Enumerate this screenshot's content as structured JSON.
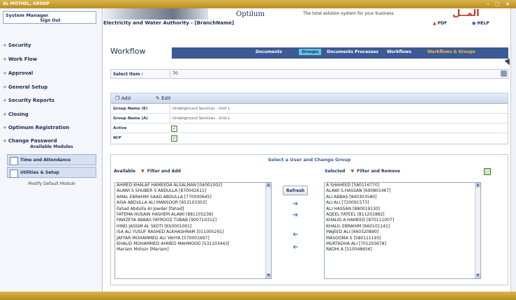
{
  "titlebar": {
    "text": "AL MOTHEL, GROUP",
    "buttons": "– □ ×"
  },
  "sidebar": {
    "user_name": "System Manager",
    "sign_out": "Sign Out",
    "items": [
      {
        "label": "Security"
      },
      {
        "label": "Work Flow"
      },
      {
        "label": "Approval"
      },
      {
        "label": "General Setup"
      },
      {
        "label": "Security Reports"
      },
      {
        "label": "Closing"
      },
      {
        "label": "Optimum Registration"
      },
      {
        "label": "Change Password"
      }
    ],
    "modules_title": "Available Modules",
    "modules": [
      {
        "label": "Time and Attendance"
      },
      {
        "label": "Utilities & Setup"
      }
    ],
    "modify_default": "Modify Default Module"
  },
  "header": {
    "product": "Optilum",
    "tagline": "The total solution system for your business",
    "arabic_logo": "المــل",
    "authority": "Electricity and Water Authority - [BranchName]",
    "pdf_label": "PDF",
    "help_label": "HELP"
  },
  "workflow": {
    "title": "Workflow",
    "tabs": [
      {
        "label": "Documents"
      },
      {
        "label": "Groups"
      },
      {
        "label": "Documents Processes"
      },
      {
        "label": "Workflows"
      },
      {
        "label": "Workflows & Groups"
      }
    ]
  },
  "select_row": {
    "label": "Select Item :",
    "value": "70"
  },
  "group": {
    "toolbar": {
      "add": "Add",
      "edit": "Edit"
    },
    "rows": [
      {
        "label": "Group Name (E)",
        "value": "Underground Services - Unit L"
      },
      {
        "label": "Group Name (A)",
        "value": "Underground Services - Unit L"
      },
      {
        "label": "Active",
        "value": "✓"
      },
      {
        "label": "W/F",
        "value": "✓"
      }
    ]
  },
  "members": {
    "title": "Select a User and Change Group",
    "available_label": "Available",
    "available_filter": "Filter and Add",
    "selected_label": "Selected",
    "selected_filter": "Filter and Remove",
    "refresh": "Refresh",
    "available": [
      "AHMED KHALAF HAMEEDA ALSALMAN [04001002]",
      "ALAWI S SHUBER S ABDULLA [870042611]",
      "AMAL EBRAHIM SAAD ABDULLA [770000645]",
      "ASIA ABDULLA ALI MANSOOR [653103303]",
      "Fahad Abdulla Al-Jowder [fahad]",
      "FATEMA HUSAIN HASHEM ALAWI [881105238]",
      "FAWZEYA ABBAS FAYROOZ TUBAB [900710312]",
      "HIND JASSIM AL SKOTI [650001091]",
      "ISA ALI YUSUF RASHED ALKHASHRAM [011005291]",
      "JAFFAR MOHAMMED ALI YAHYA [570001697]",
      "KHALID MOHAMMED AHMED MAHMOOD [531103443]",
      "Mariam Mohsin [Mariam]"
    ],
    "selected": [
      "A SHAHEED [580116770]",
      "ALAWI S.HASSAN [690801467]",
      "ALI ABBAS [840303580]",
      "ALI ALI [720091573]",
      "ALI HASSAN [880019130]",
      "AQEEL FATEEL [811201882]",
      "KHALID A.HAMEED [870111007]",
      "KHALIL EBRAHIM [660101141]",
      "MAJEED ALI [660320890]",
      "MASOOMA S [580111195]",
      "MURTADHA ALI [701203678]",
      "RADHI A [510048656]"
    ]
  }
}
